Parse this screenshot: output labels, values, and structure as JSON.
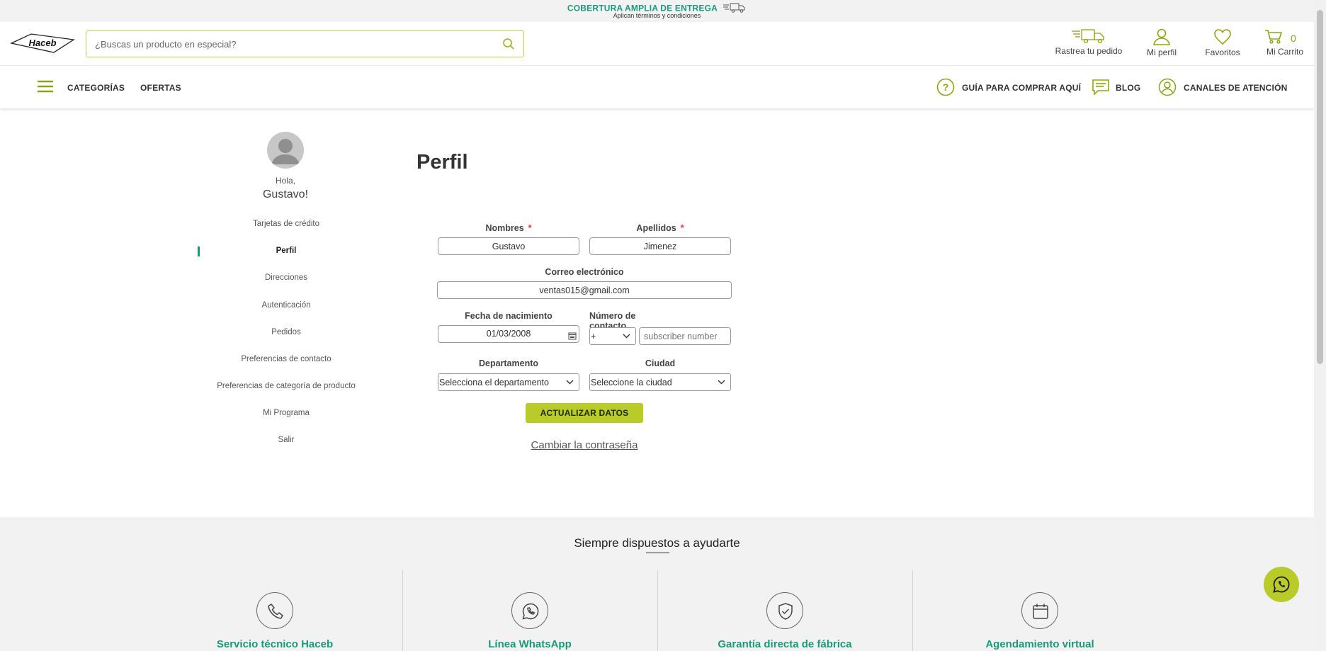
{
  "promo": {
    "title": "COBERTURA AMPLIA DE ENTREGA",
    "subtitle": "Aplican términos y condiciones"
  },
  "header": {
    "logo_text": "Haceb",
    "search_placeholder": "¿Buscas un producto en especial?",
    "track_order": "Rastrea tu pedido",
    "profile": "Mi perfil",
    "favorites": "Favoritos",
    "cart": "Mi Carrito",
    "cart_count": "0"
  },
  "nav": {
    "categories": "CATEGORÍAS",
    "offers": "OFERTAS",
    "guide": "GUÍA PARA COMPRAR AQUÍ",
    "blog": "BLOG",
    "channels": "CANALES DE ATENCIÓN"
  },
  "sidebar": {
    "greeting": "Hola,",
    "user_name": "Gustavo!",
    "items": [
      {
        "label": "Tarjetas de crédito"
      },
      {
        "label": "Perfil"
      },
      {
        "label": "Direcciones"
      },
      {
        "label": "Autenticación"
      },
      {
        "label": "Pedidos"
      },
      {
        "label": "Preferencias de contacto"
      },
      {
        "label": "Preferencias de categoría de producto"
      },
      {
        "label": "Mi Programa"
      },
      {
        "label": "Salir"
      }
    ]
  },
  "form": {
    "title": "Perfil",
    "first_name_label": "Nombres",
    "first_name_value": "Gustavo",
    "last_name_label": "Apellidos",
    "last_name_value": "Jimenez",
    "email_label": "Correo electrónico",
    "email_value": "ventas015@gmail.com",
    "birthdate_label": "Fecha de nacimiento",
    "birthdate_value": "01/03/2008",
    "phone_label": "Número de contacto",
    "phone_prefix": "+",
    "phone_placeholder": "subscriber number",
    "department_label": "Departamento",
    "department_value": "Selecciona el departamento",
    "city_label": "Ciudad",
    "city_value": "Seleccione la ciudad",
    "submit": "ACTUALIZAR DATOS",
    "change_password": "Cambiar la contraseña"
  },
  "help": {
    "title": "Siempre dispuestos a ayudarte",
    "items": [
      {
        "label": "Servicio técnico Haceb",
        "icon": "phone-icon"
      },
      {
        "label": "Línea WhatsApp",
        "icon": "whatsapp-icon"
      },
      {
        "label": "Garantía directa de fábrica",
        "icon": "shield-check-icon"
      },
      {
        "label": "Agendamiento virtual",
        "icon": "calendar-icon"
      }
    ]
  },
  "colors": {
    "accent_green": "#b8cb28",
    "teal": "#1a9a7a"
  }
}
